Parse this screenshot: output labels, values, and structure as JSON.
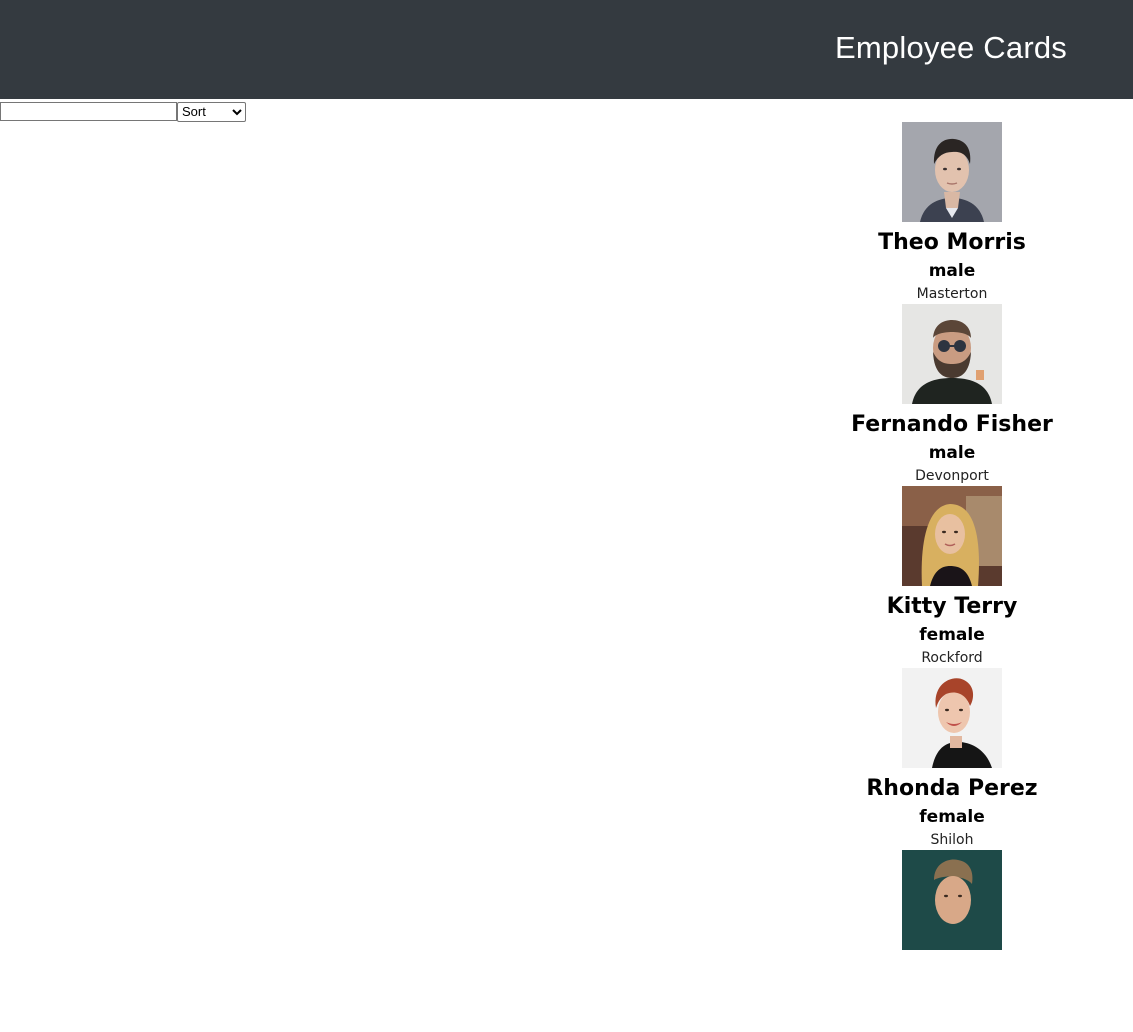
{
  "header": {
    "title": "Employee Cards"
  },
  "controls": {
    "search_value": "",
    "search_placeholder": "",
    "sort_selected": "Sort"
  },
  "employees": [
    {
      "name": "Theo Morris",
      "gender": "male",
      "city": "Masterton",
      "photo": "man-short-hair-photo"
    },
    {
      "name": "Fernando Fisher",
      "gender": "male",
      "city": "Devonport",
      "photo": "man-sunglasses-beard-photo"
    },
    {
      "name": "Kitty Terry",
      "gender": "female",
      "city": "Rockford",
      "photo": "woman-blonde-hair-photo"
    },
    {
      "name": "Rhonda Perez",
      "gender": "female",
      "city": "Shiloh",
      "photo": "woman-short-red-hair-photo"
    },
    {
      "name": "",
      "gender": "",
      "city": "",
      "photo": "man-teal-background-photo"
    }
  ],
  "colors": {
    "header_bg": "#343a40",
    "header_text": "#ffffff",
    "page_bg": "#ffffff"
  }
}
